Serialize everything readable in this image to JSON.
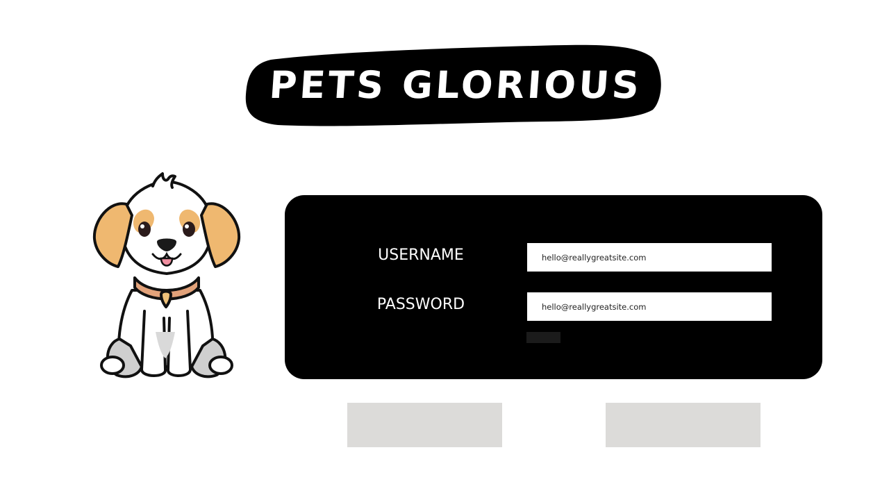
{
  "brand": {
    "title": "PETS GLORIOUS"
  },
  "login": {
    "username_label": "USERNAME",
    "username_value": "hello@reallygreatsite.com",
    "password_label": "PASSWORD",
    "password_value": "hello@reallygreatsite.com"
  },
  "mascot": {
    "icon": "puppy-icon"
  },
  "colors": {
    "background": "#ffffff",
    "panel": "#000000",
    "input_bg": "#ffffff",
    "button_gray": "#dcdbd9",
    "dog_tan": "#efb870",
    "dog_shadow": "#cfcfcf",
    "collar": "#e2a27a"
  }
}
